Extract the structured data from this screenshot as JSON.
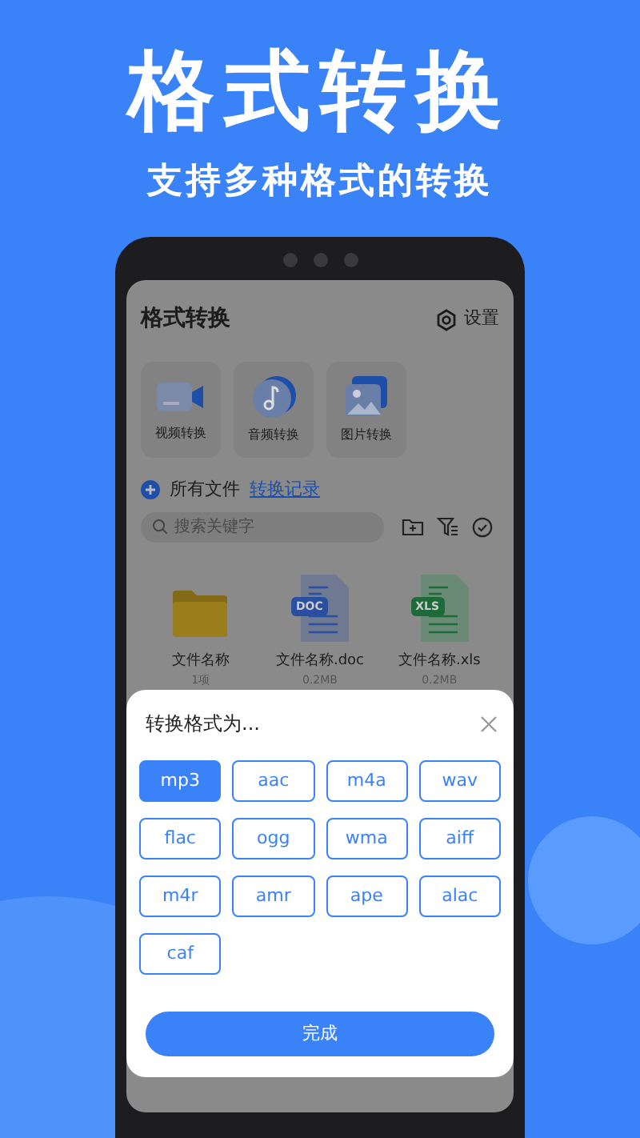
{
  "headline": "格式转换",
  "subtitle": "支持多种格式的转换",
  "app": {
    "title": "格式转换",
    "settings": "设置",
    "tools": [
      {
        "kind": "video",
        "label": "视频转换"
      },
      {
        "kind": "audio",
        "label": "音频转换"
      },
      {
        "kind": "image",
        "label": "图片转换"
      }
    ],
    "all_files": "所有文件",
    "history_link": "转换记录",
    "search": {
      "placeholder": "搜索关键字"
    },
    "files": [
      {
        "kind": "folder",
        "name": "文件名称",
        "meta": "1项"
      },
      {
        "kind": "doc",
        "badge": "DOC",
        "name": "文件名称.doc",
        "meta": "0.2MB"
      },
      {
        "kind": "xls",
        "badge": "XLS",
        "name": "文件名称.xls",
        "meta": "0.2MB"
      }
    ]
  },
  "sheet": {
    "title": "转换格式为...",
    "formats": [
      {
        "label": "mp3",
        "selected": true
      },
      {
        "label": "aac",
        "selected": false
      },
      {
        "label": "m4a",
        "selected": false
      },
      {
        "label": "wav",
        "selected": false
      },
      {
        "label": "flac",
        "selected": false
      },
      {
        "label": "ogg",
        "selected": false
      },
      {
        "label": "wma",
        "selected": false
      },
      {
        "label": "aiff",
        "selected": false
      },
      {
        "label": "m4r",
        "selected": false
      },
      {
        "label": "amr",
        "selected": false
      },
      {
        "label": "ape",
        "selected": false
      },
      {
        "label": "alac",
        "selected": false
      },
      {
        "label": "caf",
        "selected": false
      }
    ],
    "confirm": "完成"
  }
}
